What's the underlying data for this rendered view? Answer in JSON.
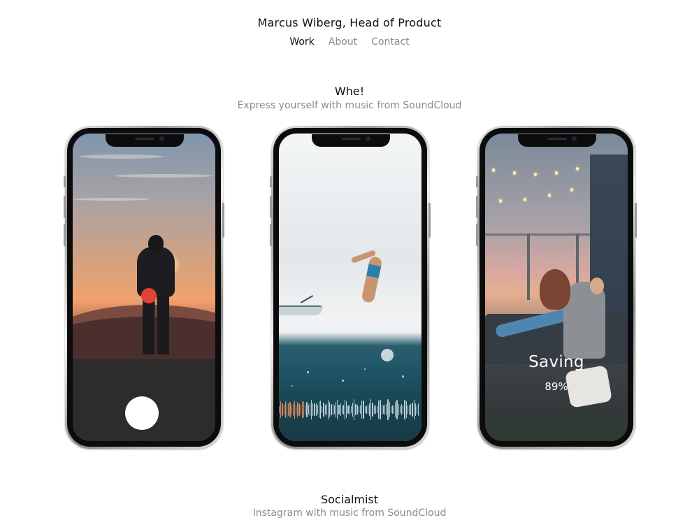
{
  "header": {
    "title": "Marcus Wiberg, Head of Product",
    "nav": [
      {
        "label": "Work",
        "active": true
      },
      {
        "label": "About",
        "active": false
      },
      {
        "label": "Contact",
        "active": false
      }
    ]
  },
  "projects": [
    {
      "title": "Whe!",
      "subtitle": "Express yourself with music from SoundCloud"
    },
    {
      "title": "Socialmist",
      "subtitle": "Instagram with music from SoundCloud"
    }
  ],
  "phones": {
    "saving": {
      "label": "Saving",
      "percent": "89%"
    }
  },
  "colors": {
    "text": "#111111",
    "muted": "#8a8a8a",
    "record_dot": "#e24236",
    "waveform_played": "#e0875c",
    "waveform_unplayed": "#b9d0d8"
  },
  "waveform": {
    "played_fraction": 0.2
  }
}
